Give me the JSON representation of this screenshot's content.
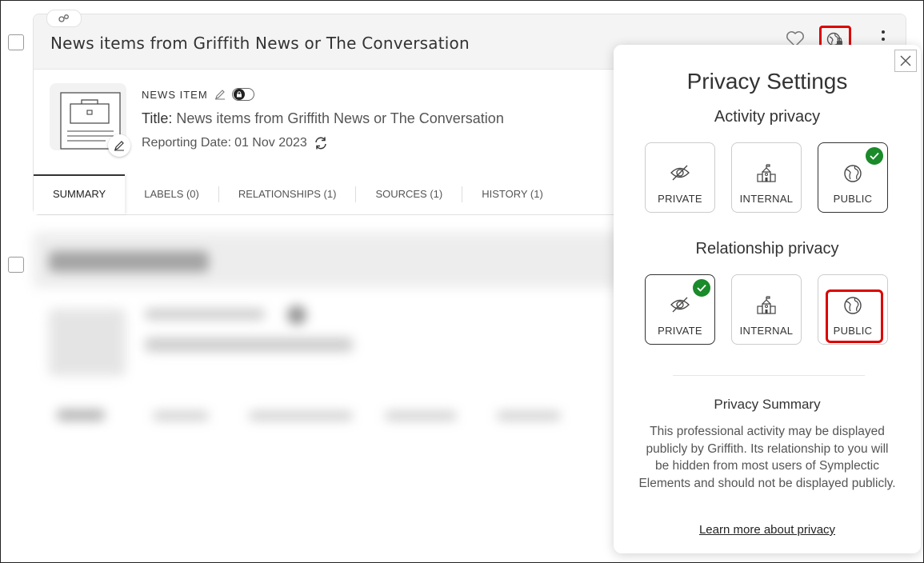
{
  "item": {
    "title": "News items from Griffith News or The Conversation",
    "type_label": "NEWS ITEM",
    "title_label": "Title:",
    "title_value": "News items from Griffith News or The Conversation",
    "reporting_label": "Reporting Date:",
    "reporting_value": "01 Nov 2023"
  },
  "tabs": [
    {
      "label": "SUMMARY",
      "active": true
    },
    {
      "label": "LABELS (0)"
    },
    {
      "label": "RELATIONSHIPS (1)"
    },
    {
      "label": "SOURCES (1)"
    },
    {
      "label": "HISTORY (1)"
    }
  ],
  "popup": {
    "title": "Privacy Settings",
    "activity_title": "Activity privacy",
    "relationship_title": "Relationship privacy",
    "activity_options": [
      {
        "label": "PRIVATE",
        "icon": "eye-off-icon",
        "selected": false
      },
      {
        "label": "INTERNAL",
        "icon": "school-icon",
        "selected": false
      },
      {
        "label": "PUBLIC",
        "icon": "globe-icon",
        "selected": true
      }
    ],
    "relationship_options": [
      {
        "label": "PRIVATE",
        "icon": "eye-off-icon",
        "selected": true
      },
      {
        "label": "INTERNAL",
        "icon": "school-icon",
        "selected": false
      },
      {
        "label": "PUBLIC",
        "icon": "globe-icon",
        "selected": false
      }
    ],
    "summary_title": "Privacy Summary",
    "summary_text": "This professional activity may be displayed publicly by Griffith. Its relationship to you will be hidden from most users of Symplectic Elements and should not be displayed publicly.",
    "learn_more": "Learn more about privacy"
  },
  "colors": {
    "selected_check": "#1a8a2a",
    "highlight": "#dd0000"
  }
}
